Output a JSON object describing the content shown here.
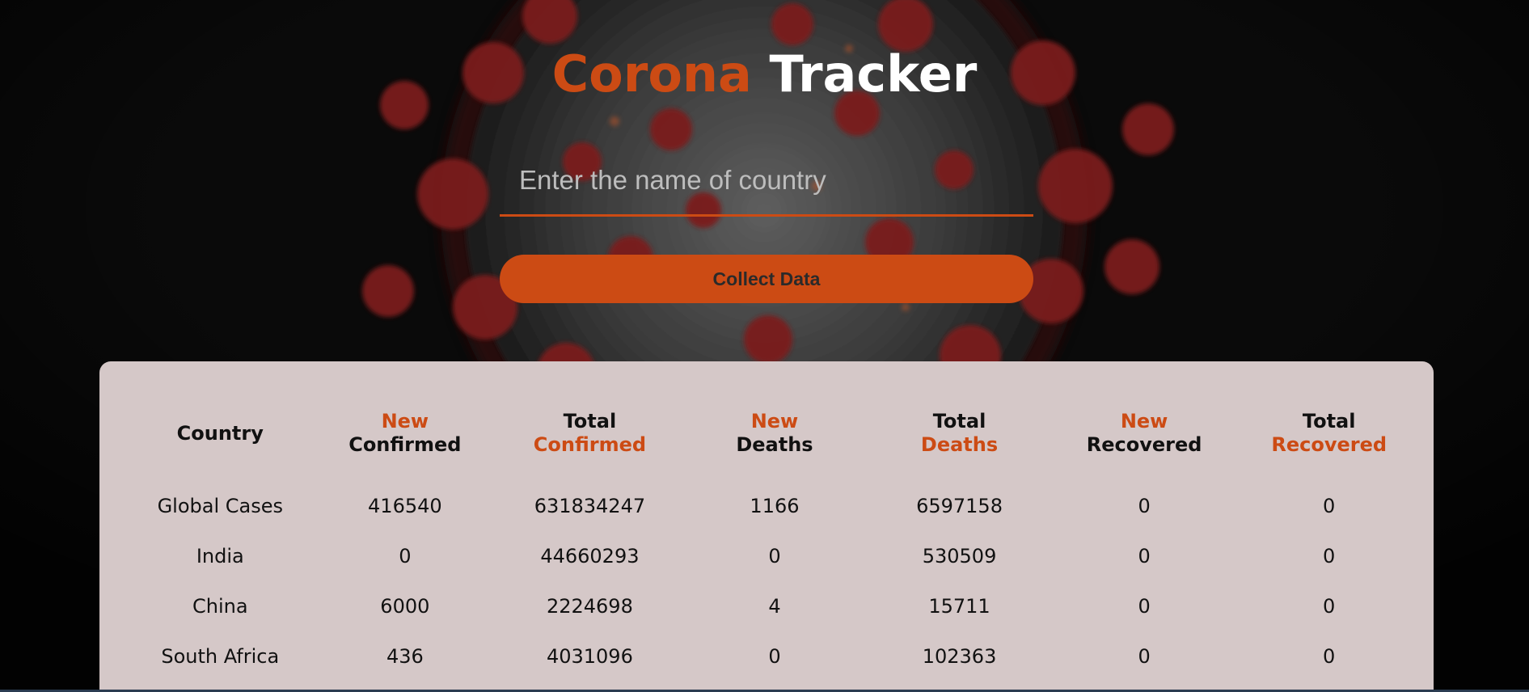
{
  "header": {
    "title_part1": "Corona",
    "title_part2": "Tracker"
  },
  "search": {
    "placeholder": "Enter the name of country",
    "value": ""
  },
  "collect_button": {
    "label": "Collect Data"
  },
  "table": {
    "columns": [
      {
        "line1": "",
        "line2": "Country",
        "accent_line": 0
      },
      {
        "line1": "New",
        "line2": "Confirmed",
        "accent_line": 1
      },
      {
        "line1": "Total",
        "line2": "Confirmed",
        "accent_line": 2
      },
      {
        "line1": "New",
        "line2": "Deaths",
        "accent_line": 1
      },
      {
        "line1": "Total",
        "line2": "Deaths",
        "accent_line": 2
      },
      {
        "line1": "New",
        "line2": "Recovered",
        "accent_line": 1
      },
      {
        "line1": "Total",
        "line2": "Recovered",
        "accent_line": 2
      }
    ],
    "rows": [
      [
        "Global Cases",
        "416540",
        "631834247",
        "1166",
        "6597158",
        "0",
        "0"
      ],
      [
        "India",
        "0",
        "44660293",
        "0",
        "530509",
        "0",
        "0"
      ],
      [
        "China",
        "6000",
        "2224698",
        "4",
        "15711",
        "0",
        "0"
      ],
      [
        "South Africa",
        "436",
        "4031096",
        "0",
        "102363",
        "0",
        "0"
      ]
    ]
  },
  "colors": {
    "accent": "#cc4b14",
    "background": "#0a0a0a",
    "panel": "#d5c8c8",
    "title_white": "#ffffff"
  },
  "icons": {
    "background": "coronavirus-image"
  }
}
